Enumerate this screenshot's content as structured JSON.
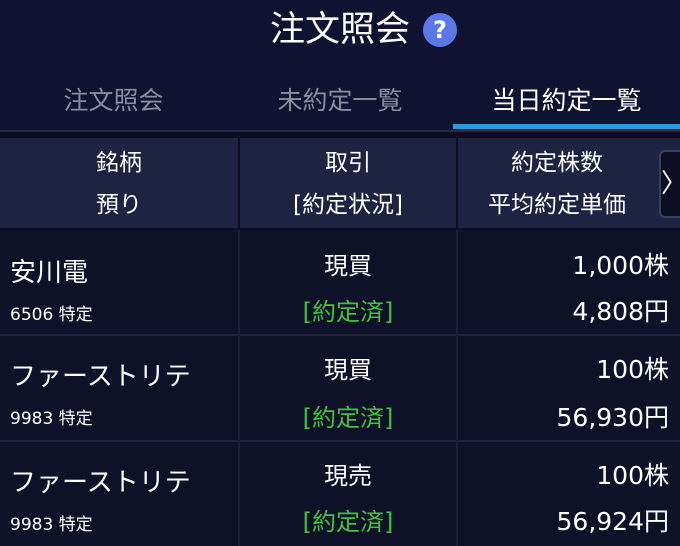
{
  "header": {
    "title": "注文照会",
    "help_icon": "?"
  },
  "tabs": [
    {
      "label": "注文照会",
      "active": false
    },
    {
      "label": "未約定一覧",
      "active": false
    },
    {
      "label": "当日約定一覧",
      "active": true
    }
  ],
  "table": {
    "columns": [
      {
        "line1": "銘柄",
        "line2": "預り"
      },
      {
        "line1": "取引",
        "line2": "[約定状況]"
      },
      {
        "line1": "約定株数",
        "line2": "平均約定単価"
      }
    ],
    "next_arrow": "〉",
    "rows": [
      {
        "name": "安川電",
        "code": "6506 特定",
        "trade": "現買",
        "status": "[約定済]",
        "qty": "1,000株",
        "price": "4,808円"
      },
      {
        "name": "ファーストリテ",
        "code": "9983 特定",
        "trade": "現買",
        "status": "[約定済]",
        "qty": "100株",
        "price": "56,930円"
      },
      {
        "name": "ファーストリテ",
        "code": "9983 特定",
        "trade": "現売",
        "status": "[約定済]",
        "qty": "100株",
        "price": "56,924円"
      }
    ]
  },
  "colors": {
    "background": "#0c0d22",
    "header_bg": "#1d2341",
    "accent": "#2a9be0",
    "status_green": "#3cc43c",
    "help_blue": "#5b78e6"
  }
}
